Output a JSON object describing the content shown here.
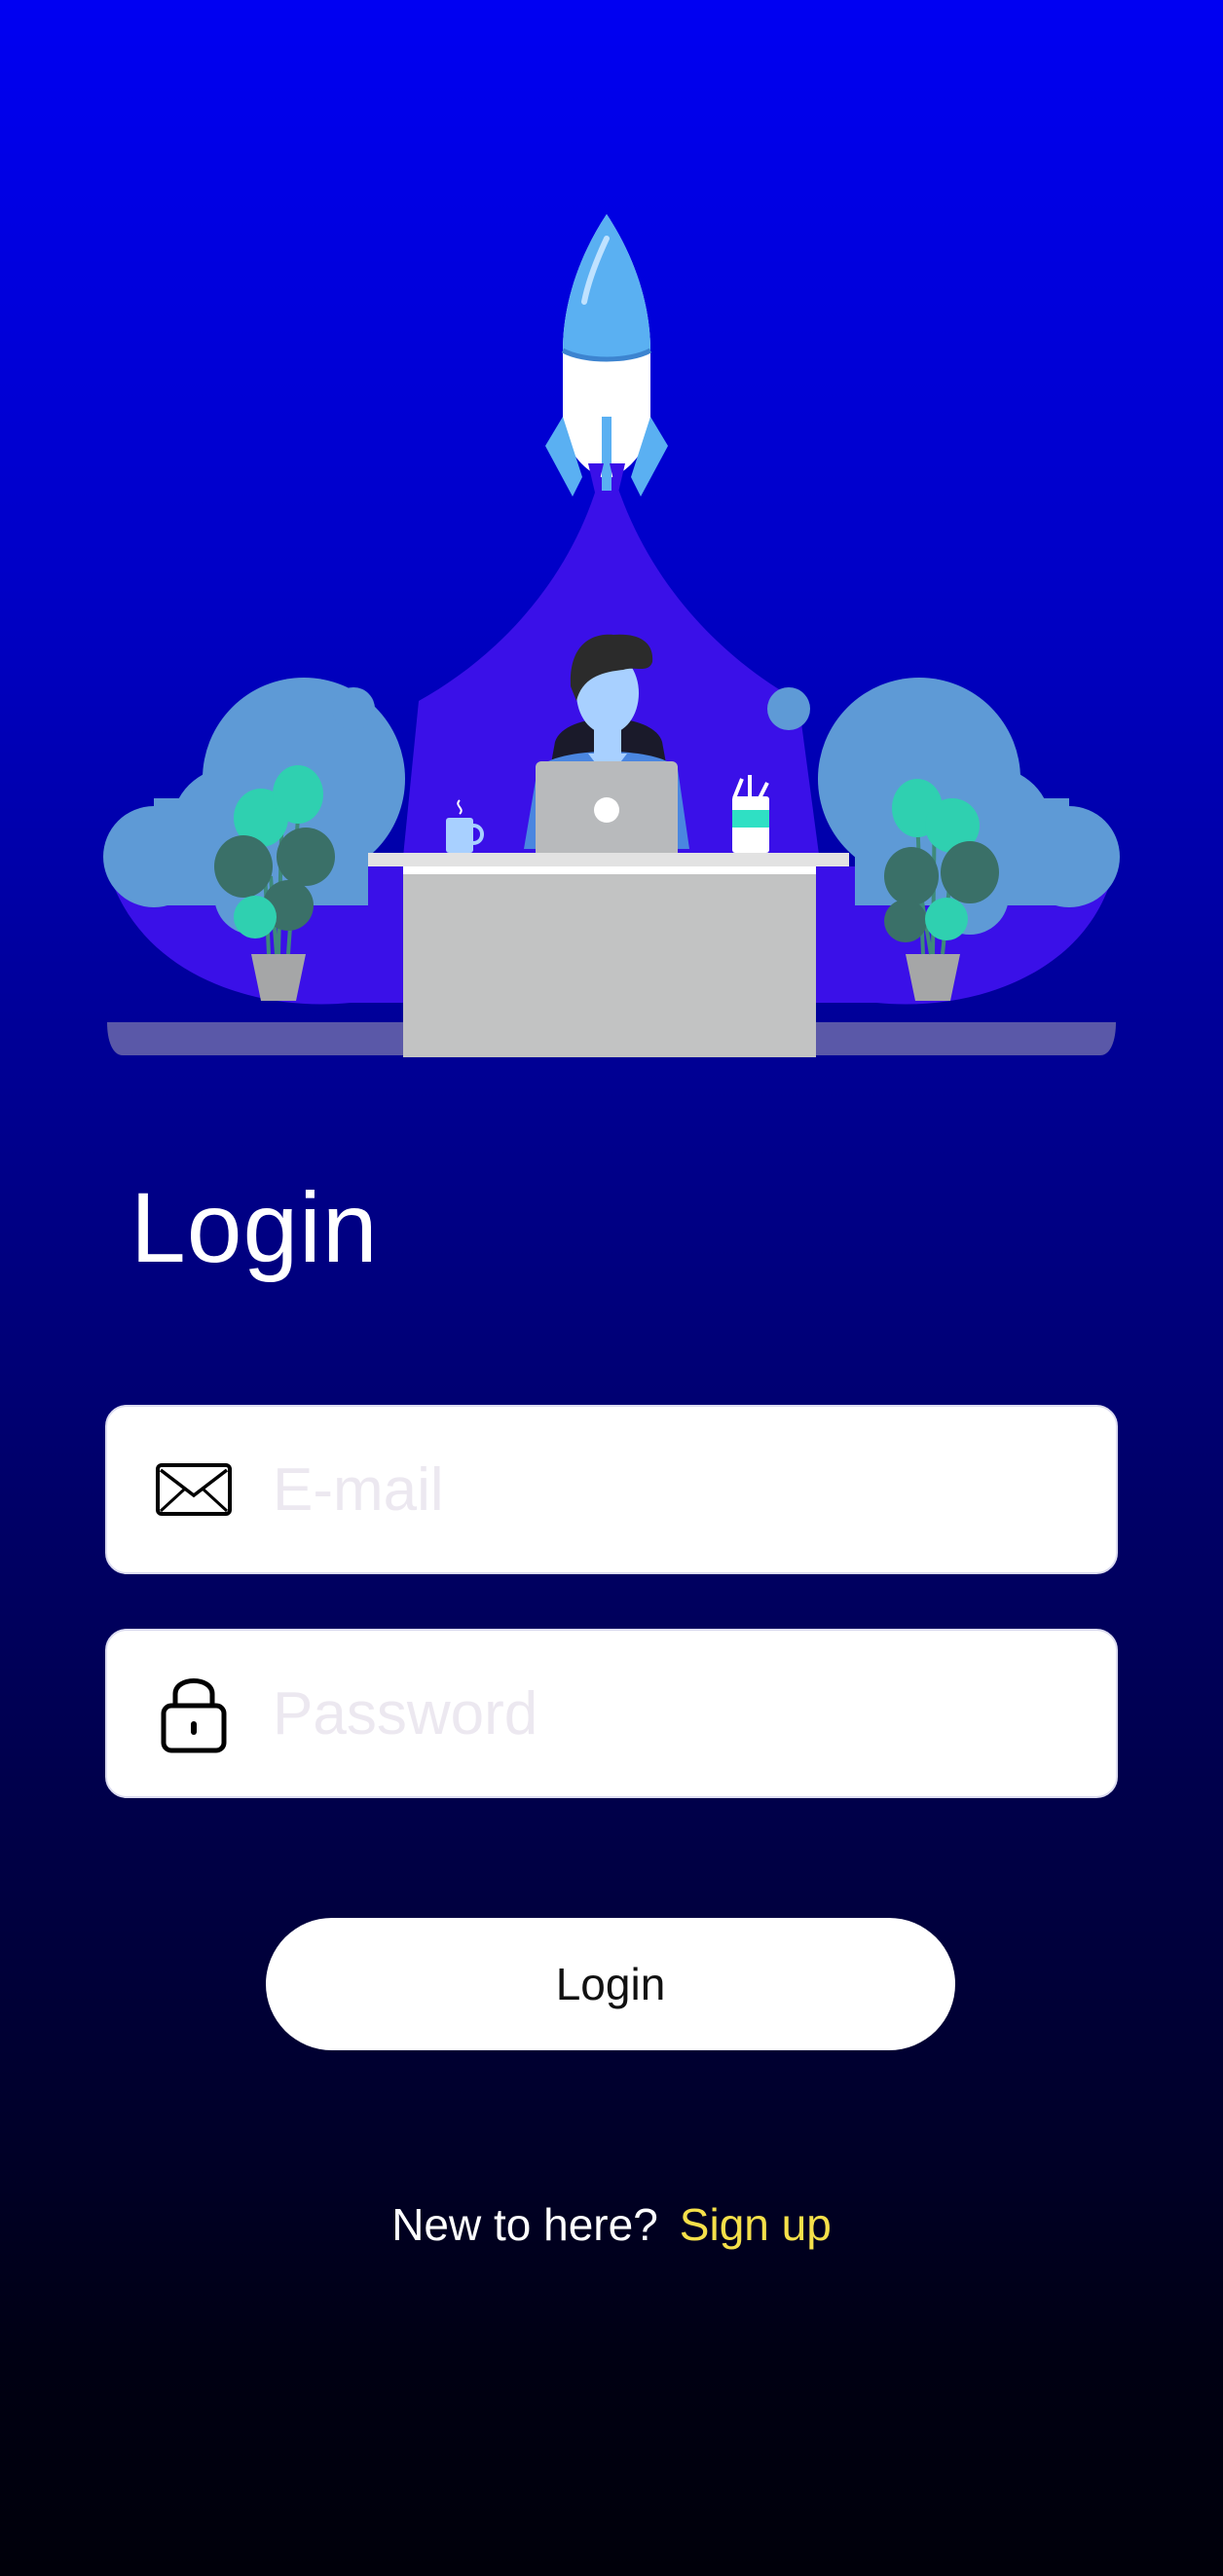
{
  "login": {
    "title": "Login",
    "email": {
      "placeholder": "E-mail",
      "value": "",
      "icon": "envelope-icon"
    },
    "password": {
      "placeholder": "Password",
      "value": "",
      "icon": "lock-icon"
    },
    "submit_label": "Login",
    "signup_prompt": "New to here?",
    "signup_link": "Sign up"
  },
  "colors": {
    "background_top": "#0000f2",
    "background_bottom": "#00000a",
    "link": "#f5e04a",
    "field_bg": "#ffffff",
    "placeholder": "#ece8f0"
  }
}
